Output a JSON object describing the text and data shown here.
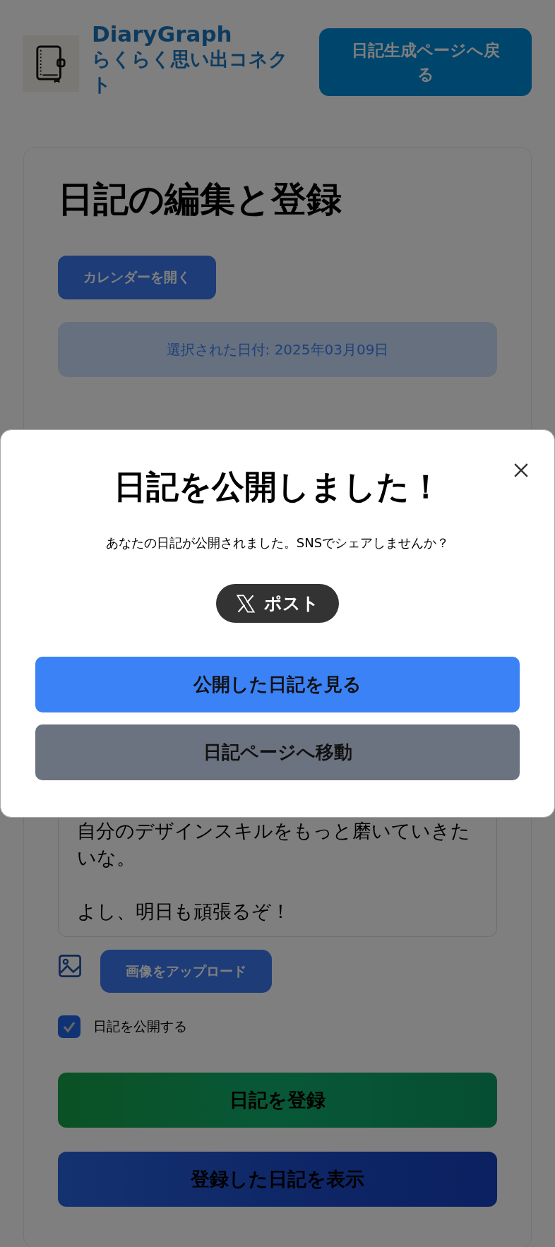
{
  "header": {
    "app_name": "DiaryGraph",
    "tagline": "らくらく思い出コネクト",
    "back_button": "日記生成ページへ戻る"
  },
  "editor": {
    "heading": "日記の編集と登録",
    "calendar_button": "カレンダーを開く",
    "selected_date": "選択された日付: 2025年03月09日",
    "body_paragraphs": [
      "自分のデザインスキルをもっと磨いていきたいな。",
      "よし、明日も頑張るぞ！"
    ],
    "upload_button": "画像をアップロード",
    "publish": {
      "label": "日記を公開する",
      "checked": true
    },
    "register_button": "日記を登録",
    "view_button": "登録した日記を表示"
  },
  "modal": {
    "title": "日記を公開しました！",
    "message": "あなたの日記が公開されました。SNSでシェアしませんか？",
    "post_button": "ポスト",
    "view_public_button": "公開した日記を見る",
    "diary_page_button": "日記ページへ移動"
  }
}
